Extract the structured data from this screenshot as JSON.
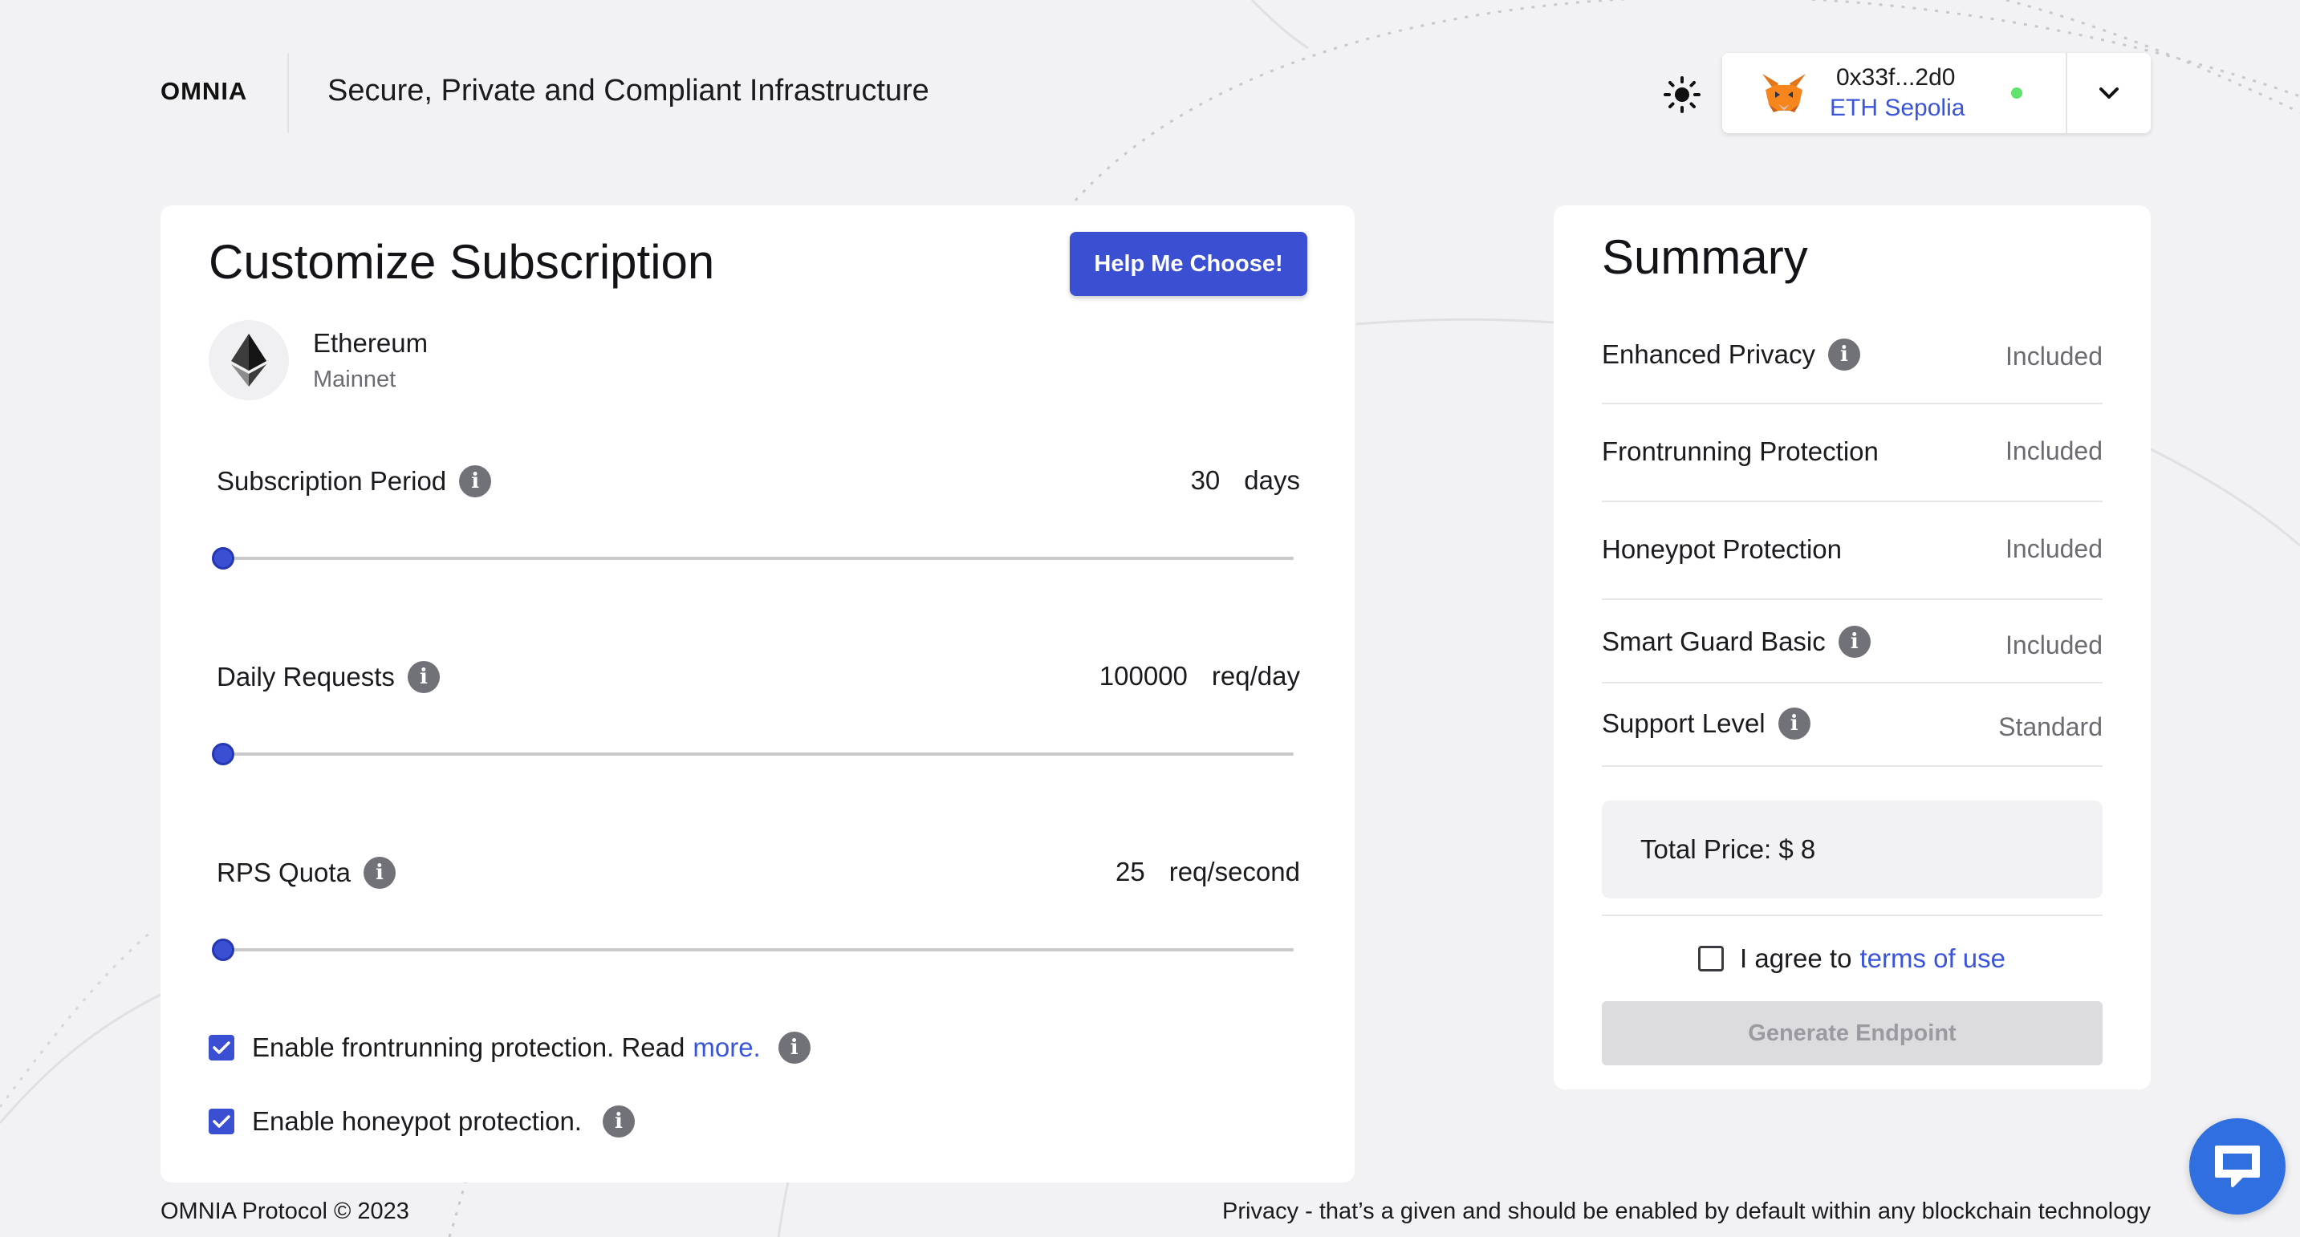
{
  "header": {
    "brand": "OMNIA",
    "tagline": "Secure, Private and Compliant Infrastructure",
    "theme_icon": "sun-icon",
    "wallet": {
      "address": "0x33f...2d0",
      "network": "ETH Sepolia",
      "status_color": "#5fe36c",
      "icon": "metamask-fox-icon"
    }
  },
  "customize": {
    "title": "Customize Subscription",
    "help_button": "Help Me Choose!",
    "network": {
      "name": "Ethereum",
      "sub": "Mainnet",
      "icon": "ethereum-icon"
    },
    "sliders": [
      {
        "label": "Subscription Period",
        "value": "30",
        "unit": "days",
        "level": 0
      },
      {
        "label": "Daily Requests",
        "value": "100000",
        "unit": "req/day",
        "level": 0
      },
      {
        "label": "RPS Quota",
        "value": "25",
        "unit": "req/second",
        "level": 0
      }
    ],
    "frontrunning": {
      "text": "Enable frontrunning protection. Read",
      "link": "more.",
      "checked": true
    },
    "honeypot": {
      "text": "Enable honeypot protection.",
      "checked": true
    }
  },
  "summary": {
    "title": "Summary",
    "rows": [
      {
        "label": "Enhanced Privacy",
        "value": "Included",
        "info": true
      },
      {
        "label": "Frontrunning Protection",
        "value": "Included",
        "info": false
      },
      {
        "label": "Honeypot Protection",
        "value": "Included",
        "info": false
      },
      {
        "label": "Smart Guard Basic",
        "value": "Included",
        "info": true
      },
      {
        "label": "Support Level",
        "value": "Standard",
        "info": true
      }
    ],
    "total": "Total Price: $ 8",
    "agree_text": "I agree to",
    "agree_link": "terms of use",
    "generate_button": "Generate Endpoint"
  },
  "footer": {
    "left": "OMNIA Protocol © 2023",
    "right": "Privacy - that’s a given and should be enabled by default within any blockchain technology"
  },
  "colors": {
    "accent": "#3b4fd3",
    "link": "#3a55d8",
    "background": "#f2f2f4"
  }
}
